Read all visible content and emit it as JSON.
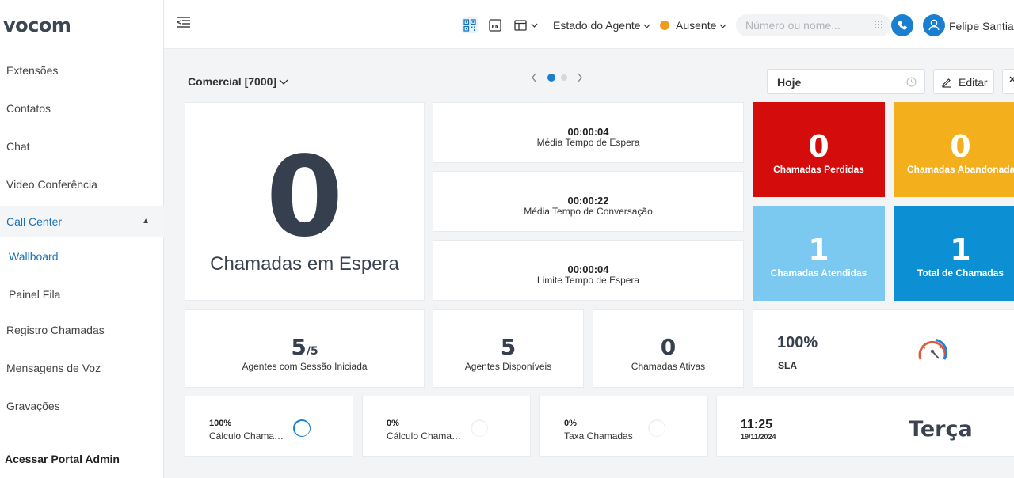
{
  "app": {
    "logo": "vocom"
  },
  "sidebar": {
    "items": [
      {
        "label": "Extensões"
      },
      {
        "label": "Contatos"
      },
      {
        "label": "Chat"
      },
      {
        "label": "Video Conferência"
      },
      {
        "label": "Call Center"
      },
      {
        "label": "Wallboard"
      },
      {
        "label": "Painel Fila"
      },
      {
        "label": "Registro Chamadas"
      },
      {
        "label": "Mensagens de Voz"
      },
      {
        "label": "Gravações"
      }
    ],
    "footer": "Acessar Portal Admin"
  },
  "header": {
    "agent_state": "Estado do Agente",
    "status": "Ausente",
    "status_color": "#f39a1b",
    "search_placeholder": "Número ou nome...",
    "user_name": "Felipe Santia"
  },
  "toolbar": {
    "queue": "Comercial [7000]",
    "date_range": "Hoje",
    "edit_label": "Editar"
  },
  "wallboard": {
    "waiting_calls": {
      "value": "0",
      "label": "Chamadas em Espera"
    },
    "times": [
      {
        "value": "00:00:04",
        "label": "Média Tempo de Espera"
      },
      {
        "value": "00:00:22",
        "label": "Média Tempo de Conversação"
      },
      {
        "value": "00:00:04",
        "label": "Limite Tempo de Espera"
      }
    ],
    "tiles": [
      {
        "value": "0",
        "label": "Chamadas Perdidas",
        "color": "#d40c0c"
      },
      {
        "value": "0",
        "label": "Chamadas Abandonadas",
        "color": "#f3af1c"
      },
      {
        "value": "1",
        "label": "Chamadas Atendidas",
        "color": "#7bc8f1"
      },
      {
        "value": "1",
        "label": "Total de Chamadas",
        "color": "#0c8fd3"
      }
    ],
    "agents_logged": {
      "value": "5",
      "total": "/5",
      "label": "Agentes com Sessão Iniciada"
    },
    "agents_available": {
      "value": "5",
      "label": "Agentes Disponíveis"
    },
    "active_calls": {
      "value": "0",
      "label": "Chamadas Ativas"
    },
    "sla": {
      "value": "100%",
      "label": "SLA"
    },
    "mini": [
      {
        "value": "100%",
        "label": "Cálculo Chamadas",
        "percent": 100
      },
      {
        "value": "0%",
        "label": "Cálculo Chamadas",
        "percent": 0
      },
      {
        "value": "0%",
        "label": "Taxa Chamadas",
        "percent": 0
      }
    ],
    "clock": {
      "time": "11:25",
      "date": "19/11/2024",
      "weekday": "Terça"
    }
  }
}
